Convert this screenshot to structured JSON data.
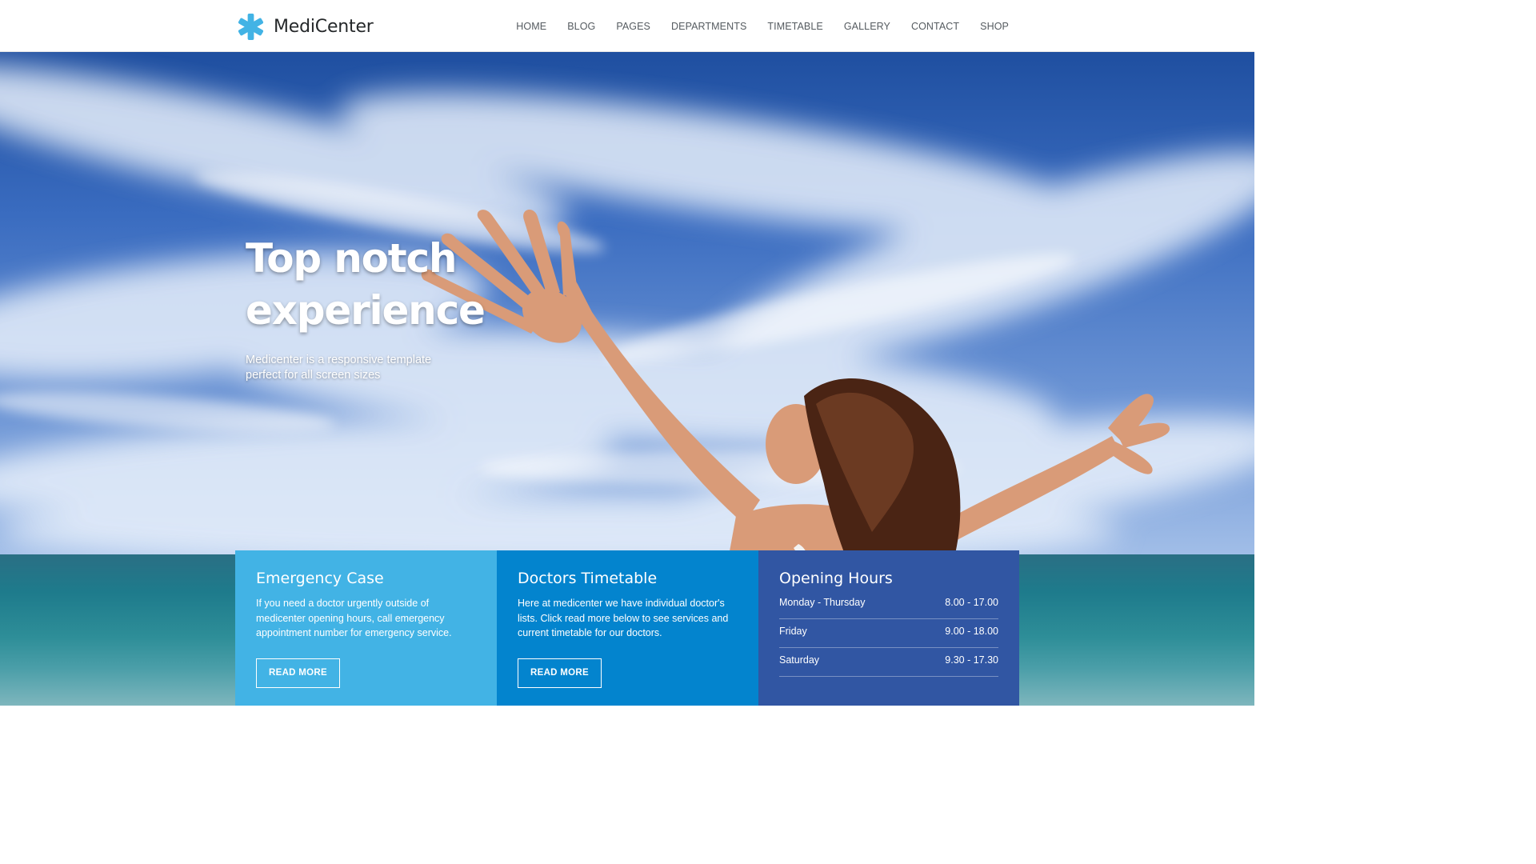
{
  "header": {
    "brand": "MediCenter",
    "nav": [
      "HOME",
      "BLOG",
      "PAGES",
      "DEPARTMENTS",
      "TIMETABLE",
      "GALLERY",
      "CONTACT",
      "SHOP"
    ]
  },
  "hero": {
    "title_line1": "Top notch",
    "title_line2": "experience",
    "subtitle_line1": "Medicenter is a responsive template",
    "subtitle_line2": "perfect for all screen sizes"
  },
  "boxes": {
    "emergency": {
      "title": "Emergency Case",
      "text": "If you need a doctor urgently outside of medicenter opening hours, call emergency appointment number for emergency service.",
      "button": "READ MORE"
    },
    "timetable": {
      "title": "Doctors Timetable",
      "text": "Here at medicenter we have individual doctor's lists. Click read more below to see services and current timetable for our doctors.",
      "button": "READ MORE"
    },
    "hours": {
      "title": "Opening Hours",
      "rows": [
        {
          "day": "Monday - Thursday",
          "time": "8.00 - 17.00"
        },
        {
          "day": "Friday",
          "time": "9.00 - 18.00"
        },
        {
          "day": "Saturday",
          "time": "9.30 - 17.30"
        }
      ]
    }
  },
  "colors": {
    "accent_light": "#42b3e5",
    "accent_mid": "#0384ce",
    "accent_dark": "#3156a3",
    "logo": "#42b3e5"
  },
  "icons": {
    "logo": "asterisk-icon"
  }
}
